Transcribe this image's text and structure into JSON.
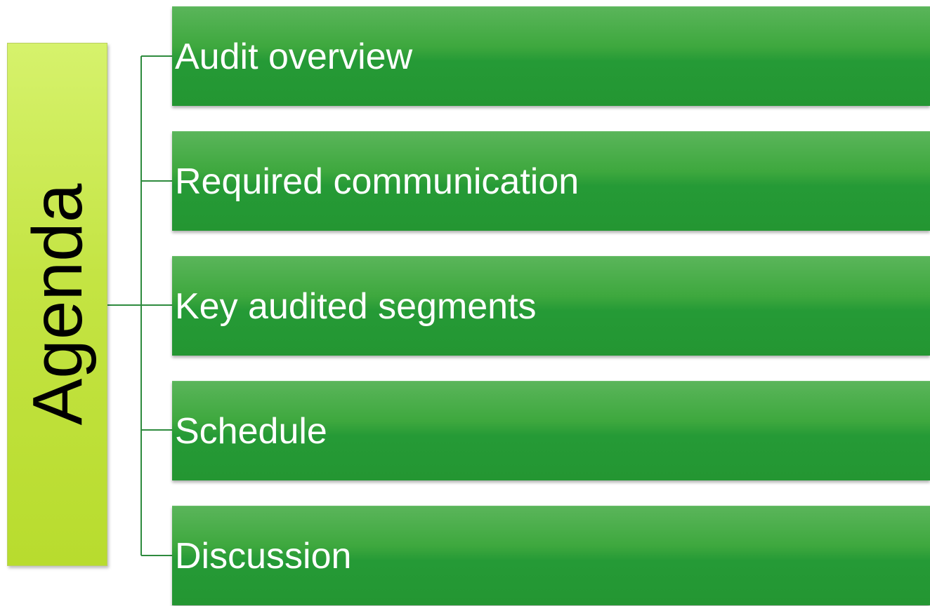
{
  "diagram": {
    "root": {
      "label": "Agenda"
    },
    "items": [
      {
        "label": "Audit overview"
      },
      {
        "label": "Required communication"
      },
      {
        "label": "Key audited segments"
      },
      {
        "label": "Schedule"
      },
      {
        "label": "Discussion"
      }
    ],
    "colors": {
      "root_fill": "#c4e443",
      "item_fill": "#259a36",
      "connector": "#2e8b3e",
      "item_text": "#ffffff",
      "root_text": "#000000"
    }
  }
}
